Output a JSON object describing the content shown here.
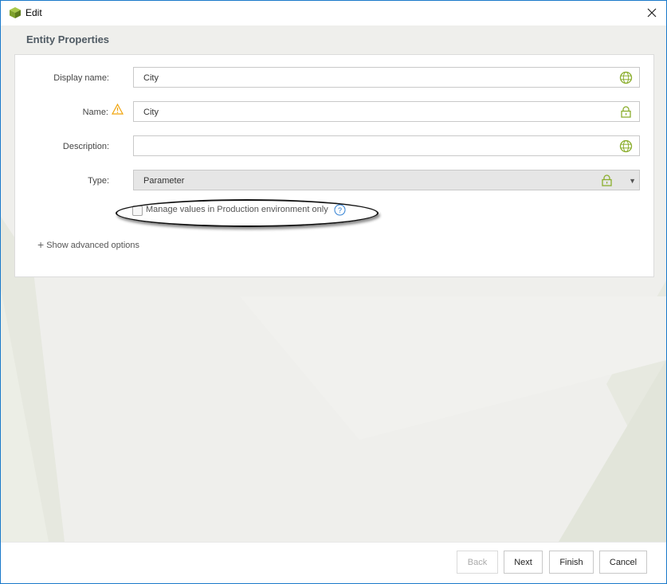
{
  "window": {
    "title": "Edit",
    "app_icon": "cube-icon"
  },
  "section": {
    "title": "Entity Properties"
  },
  "form": {
    "display_name": {
      "label": "Display name:",
      "value": "City",
      "icon": "globe-icon"
    },
    "name": {
      "label": "Name:",
      "value": "City",
      "icon": "lock-icon",
      "warning_icon": "warning-icon"
    },
    "description": {
      "label": "Description:",
      "value": "",
      "icon": "globe-icon"
    },
    "type": {
      "label": "Type:",
      "value": "Parameter",
      "icon": "lock-icon"
    },
    "manage_values": {
      "label": "Manage values in Production environment only",
      "checked": false,
      "help_icon": "help-icon"
    },
    "advanced_options": {
      "label": "Show advanced options"
    }
  },
  "footer": {
    "back": "Back",
    "next": "Next",
    "finish": "Finish",
    "cancel": "Cancel"
  },
  "colors": {
    "accent": "#8bae2e",
    "border": "#1979ca",
    "warning": "#f0a30a",
    "help": "#2f7fd2"
  }
}
